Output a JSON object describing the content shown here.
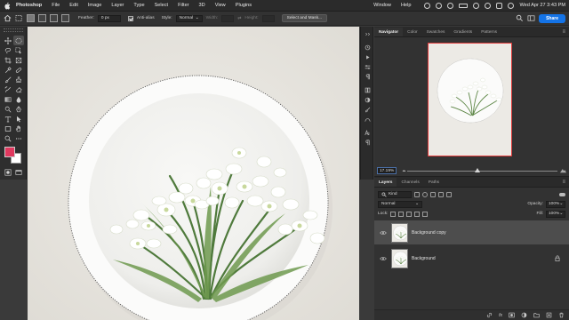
{
  "menubar": {
    "app_name": "Photoshop",
    "items": [
      "File",
      "Edit",
      "Image",
      "Layer",
      "Type",
      "Select",
      "Filter",
      "3D",
      "View",
      "Plugins"
    ],
    "window_label": "Window",
    "help_label": "Help",
    "clock": "Wed Apr 27  3:43 PM"
  },
  "options": {
    "feather_label": "Feather:",
    "feather_value": "0 px",
    "antialias_label": "Anti-alias",
    "style_label": "Style:",
    "style_value": "Normal",
    "width_label": "Width:",
    "height_label": "Height:",
    "select_mask_label": "Select and Mask...",
    "share_label": "Share"
  },
  "navigator": {
    "tabs": [
      "Navigator",
      "Color",
      "Swatches",
      "Gradients",
      "Patterns"
    ],
    "zoom": "17.19%"
  },
  "layers": {
    "tabs": [
      "Layers",
      "Channels",
      "Paths"
    ],
    "kind_label": "Kind",
    "blend_mode": "Normal",
    "opacity_label": "Opacity:",
    "opacity_value": "100%",
    "lock_label": "Lock:",
    "fill_label": "Fill:",
    "fill_value": "100%",
    "items": [
      {
        "name": "Background copy",
        "selected": true
      },
      {
        "name": "Background",
        "selected": false
      }
    ],
    "footer_fx": "fx"
  },
  "colors": {
    "foreground": "#e0385e",
    "background": "#ffffff",
    "accent": "#1473e6"
  }
}
